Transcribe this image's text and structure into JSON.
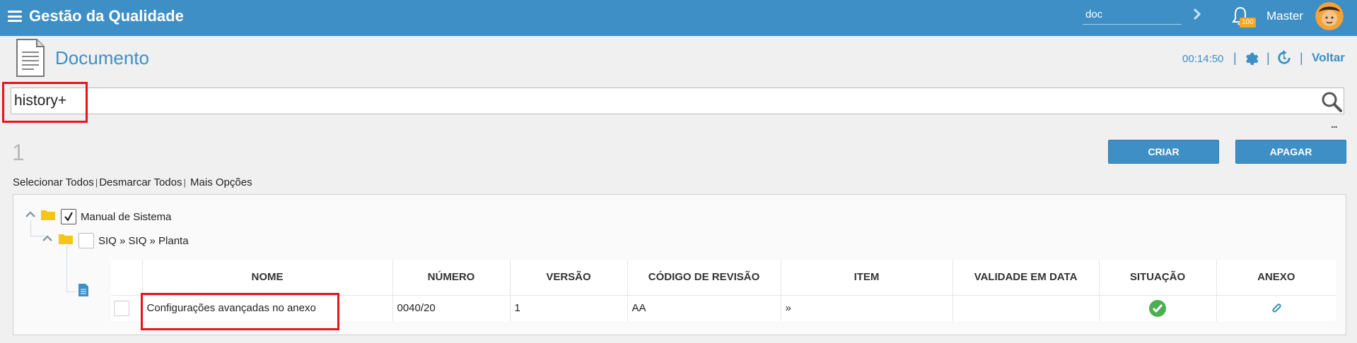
{
  "header": {
    "app_title": "Gestão da Qualidade",
    "search_value": "doc",
    "notification_count": "100",
    "user_name": "Master"
  },
  "page": {
    "title": "Documento",
    "timer": "00:14:50",
    "back_label": "Voltar"
  },
  "search": {
    "value": "history+",
    "more_label": "..."
  },
  "results": {
    "count": "1",
    "create_label": "CRIAR",
    "delete_label": "APAGAR",
    "select_all": "Selecionar Todos",
    "deselect_all": "Desmarcar Todos",
    "more_options": "Mais Opções"
  },
  "tree": {
    "root_label": "Manual de Sistema",
    "child_label": "SIQ » SIQ » Planta"
  },
  "table": {
    "columns": [
      "NOME",
      "NÚMERO",
      "VERSÃO",
      "CÓDIGO DE REVISÃO",
      "ITEM",
      "VALIDADE EM DATA",
      "SITUAÇÃO",
      "ANEXO"
    ],
    "rows": [
      {
        "nome": "Configurações avançadas no anexo",
        "numero": "0040/20",
        "versao": "1",
        "codigo_revisao": "AA",
        "item": "»",
        "validade": "",
        "situacao": "ok-check-icon",
        "anexo": "paperclip-icon"
      }
    ]
  },
  "colors": {
    "primary": "#3d8fc6",
    "highlight": "#e8141c",
    "status_ok": "#4caf50",
    "folder": "#f5c518"
  }
}
